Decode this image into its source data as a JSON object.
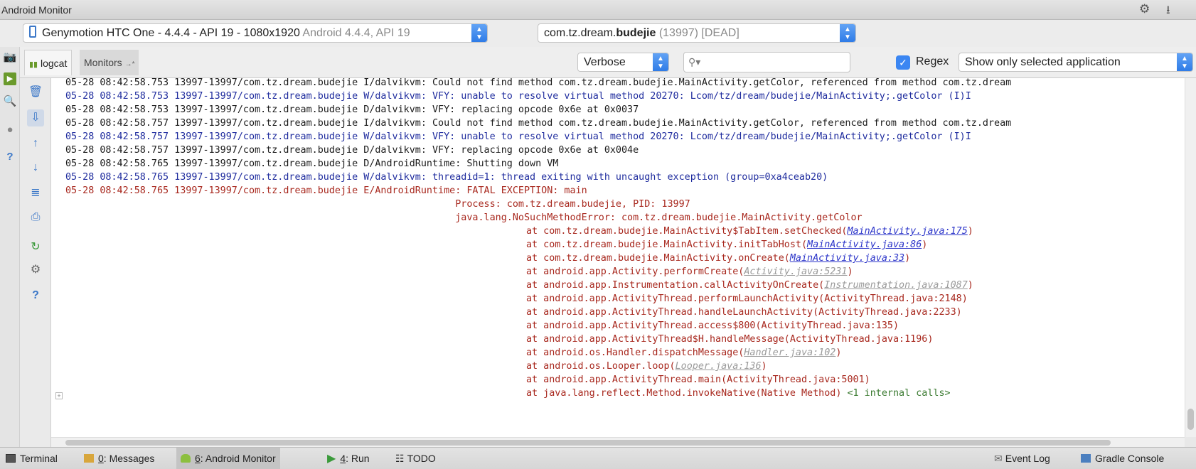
{
  "window": {
    "title": "Android Monitor"
  },
  "device_selector": {
    "device": "Genymotion HTC One - 4.4.4 - API 19 - 1080x1920",
    "device_detail": "Android 4.4.4, API 19",
    "process_prefix": "com.tz.dream.",
    "process_bold": "budejie",
    "process_suffix": " (13997) [DEAD]"
  },
  "tabs": [
    {
      "label": "logcat",
      "active": true
    },
    {
      "label": "Monitors",
      "active": false
    }
  ],
  "filters": {
    "log_level": "Verbose",
    "search_placeholder": "",
    "regex_label": "Regex",
    "regex_checked": true,
    "app_filter": "Show only selected application"
  },
  "log_lines": [
    {
      "level": "I",
      "text": "05-28 08:42:58.753 13997-13997/com.tz.dream.budejie I/dalvikvm: Could not find method com.tz.dream.budejie.MainActivity.getColor, referenced from method com.tz.dream"
    },
    {
      "level": "W",
      "text": "05-28 08:42:58.753 13997-13997/com.tz.dream.budejie W/dalvikvm: VFY: unable to resolve virtual method 20270: Lcom/tz/dream/budejie/MainActivity;.getColor (I)I"
    },
    {
      "level": "D",
      "text": "05-28 08:42:58.753 13997-13997/com.tz.dream.budejie D/dalvikvm: VFY: replacing opcode 0x6e at 0x0037"
    },
    {
      "level": "I",
      "text": "05-28 08:42:58.757 13997-13997/com.tz.dream.budejie I/dalvikvm: Could not find method com.tz.dream.budejie.MainActivity.getColor, referenced from method com.tz.dream"
    },
    {
      "level": "W",
      "text": "05-28 08:42:58.757 13997-13997/com.tz.dream.budejie W/dalvikvm: VFY: unable to resolve virtual method 20270: Lcom/tz/dream/budejie/MainActivity;.getColor (I)I"
    },
    {
      "level": "D",
      "text": "05-28 08:42:58.757 13997-13997/com.tz.dream.budejie D/dalvikvm: VFY: replacing opcode 0x6e at 0x004e"
    },
    {
      "level": "D",
      "text": "05-28 08:42:58.765 13997-13997/com.tz.dream.budejie D/AndroidRuntime: Shutting down VM"
    },
    {
      "level": "W",
      "text": "05-28 08:42:58.765 13997-13997/com.tz.dream.budejie W/dalvikvm: threadid=1: thread exiting with uncaught exception (group=0xa4ceab20)"
    },
    {
      "level": "E",
      "text": "05-28 08:42:58.765 13997-13997/com.tz.dream.budejie E/AndroidRuntime: FATAL EXCEPTION: main"
    },
    {
      "level": "E",
      "text": "                                                                    Process: com.tz.dream.budejie, PID: 13997"
    },
    {
      "level": "E",
      "text": "                                                                    java.lang.NoSuchMethodError: com.tz.dream.budejie.MainActivity.getColor"
    }
  ],
  "stack_frames": [
    {
      "prefix": "at com.tz.dream.budejie.MainActivity$TabItem.setChecked(",
      "link": "MainActivity.java:175",
      "link_style": "blue",
      "suffix": ")"
    },
    {
      "prefix": "at com.tz.dream.budejie.MainActivity.initTabHost(",
      "link": "MainActivity.java:86",
      "link_style": "blue",
      "suffix": ")"
    },
    {
      "prefix": "at com.tz.dream.budejie.MainActivity.onCreate(",
      "link": "MainActivity.java:33",
      "link_style": "blue",
      "suffix": ")"
    },
    {
      "prefix": "at android.app.Activity.performCreate(",
      "link": "Activity.java:5231",
      "link_style": "gray",
      "suffix": ")"
    },
    {
      "prefix": "at android.app.Instrumentation.callActivityOnCreate(",
      "link": "Instrumentation.java:1087",
      "link_style": "gray",
      "suffix": ")"
    },
    {
      "prefix": "at android.app.ActivityThread.performLaunchActivity(ActivityThread.java:2148)",
      "link": "",
      "link_style": "",
      "suffix": ""
    },
    {
      "prefix": "at android.app.ActivityThread.handleLaunchActivity(ActivityThread.java:2233)",
      "link": "",
      "link_style": "",
      "suffix": ""
    },
    {
      "prefix": "at android.app.ActivityThread.access$800(ActivityThread.java:135)",
      "link": "",
      "link_style": "",
      "suffix": ""
    },
    {
      "prefix": "at android.app.ActivityThread$H.handleMessage(ActivityThread.java:1196)",
      "link": "",
      "link_style": "",
      "suffix": ""
    },
    {
      "prefix": "at android.os.Handler.dispatchMessage(",
      "link": "Handler.java:102",
      "link_style": "gray",
      "suffix": ")"
    },
    {
      "prefix": "at android.os.Looper.loop(",
      "link": "Looper.java:136",
      "link_style": "gray",
      "suffix": ")"
    },
    {
      "prefix": "at android.app.ActivityThread.main(ActivityThread.java:5001)",
      "link": "",
      "link_style": "",
      "suffix": ""
    },
    {
      "prefix": "at java.lang.reflect.Method.invokeNative(Native Method) ",
      "link": "",
      "link_style": "",
      "suffix": "",
      "internal": "<1 internal calls>"
    }
  ],
  "status_bar": {
    "terminal": "Terminal",
    "messages_num": "0",
    "messages": ": Messages",
    "monitor_num": "6",
    "monitor": ": Android Monitor",
    "run_num": "4",
    "run": ": Run",
    "todo": "TODO",
    "event_log": "Event Log",
    "gradle_console": "Gradle Console"
  },
  "colors": {
    "info": "#1b1b1b",
    "warn": "#1f2c9e",
    "error": "#a8281e",
    "accent": "#3b86f2"
  }
}
